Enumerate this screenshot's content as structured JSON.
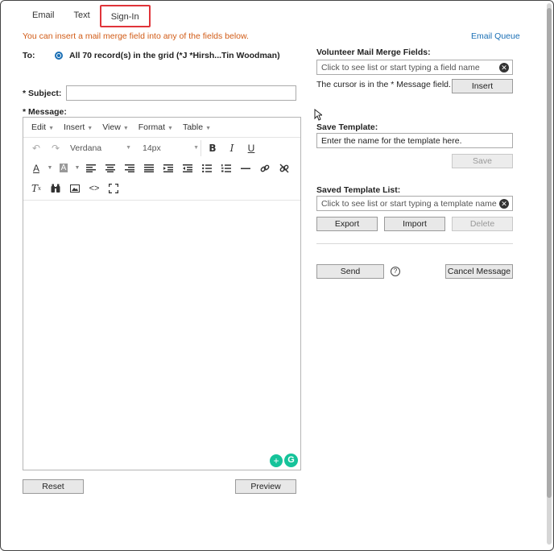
{
  "tabs": [
    {
      "label": "Email",
      "active": false
    },
    {
      "label": "Text",
      "active": false
    },
    {
      "label": "Sign-In",
      "active": true
    }
  ],
  "hint": "You can insert a mail merge field into any of the fields below.",
  "email_queue": "Email Queue",
  "to": {
    "label": "To:",
    "value": "All 70 record(s) in the grid (*J *Hirsh...Tin Woodman)"
  },
  "subject": {
    "label": "* Subject:",
    "value": ""
  },
  "message": {
    "label": "* Message:"
  },
  "editor": {
    "menus": [
      "Edit",
      "Insert",
      "View",
      "Format",
      "Table"
    ],
    "font_family": "Verdana",
    "font_size": "14px"
  },
  "merge_fields": {
    "label": "Volunteer Mail Merge Fields:",
    "placeholder": "Click to see list or start typing a field name",
    "cursor_note": "The cursor is in the * Message field.",
    "insert_label": "Insert"
  },
  "save_template": {
    "label": "Save Template:",
    "placeholder": "Enter the name for the template here.",
    "save_label": "Save"
  },
  "saved_templates": {
    "label": "Saved Template List:",
    "placeholder": "Click to see list or start typing a template name",
    "export_label": "Export",
    "import_label": "Import",
    "delete_label": "Delete"
  },
  "actions": {
    "send_label": "Send",
    "help_icon": "?",
    "cancel_label": "Cancel Message",
    "reset_label": "Reset",
    "preview_label": "Preview"
  },
  "icons": {
    "accent": "#1a6fb5",
    "grammarly": "#15c39a"
  }
}
